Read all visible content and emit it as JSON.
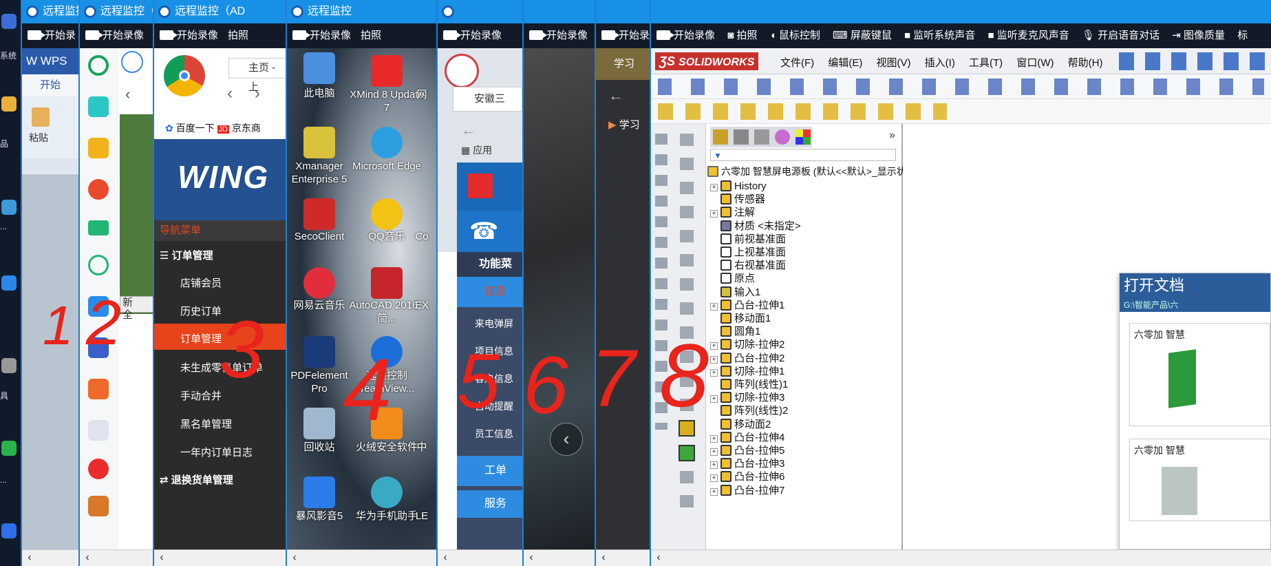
{
  "left_strip": {
    "labels": [
      "系统",
      "品",
      "...",
      "具",
      "..."
    ]
  },
  "windows": [
    {
      "title": "远程监控",
      "toolbar": [
        "开始录"
      ]
    },
    {
      "title": "远程监控（",
      "toolbar": [
        "开始录像"
      ]
    },
    {
      "title": "远程监控（AD",
      "toolbar": [
        "开始录像",
        "拍照"
      ]
    },
    {
      "title": "远程监控",
      "toolbar": [
        "开始录像",
        "拍照"
      ]
    },
    {
      "title": "",
      "toolbar": [
        "开始录像"
      ]
    },
    {
      "title": "",
      "toolbar": [
        "开始录像"
      ]
    },
    {
      "title": "",
      "toolbar": [
        "开始录"
      ]
    },
    {
      "title": "",
      "toolbar": [
        "开始录像",
        "拍照",
        "鼠标控制",
        "屏蔽键鼠",
        "监听系统声音",
        "监听麦克风声音",
        "开启语音对话",
        "图像质量",
        "标"
      ]
    }
  ],
  "w1": {
    "app": "WPS",
    "tab": "开始",
    "paste": "粘贴"
  },
  "w2": {
    "labels": [
      "新",
      "全"
    ]
  },
  "w3": {
    "tab": "主页 - 上",
    "bookmarks": [
      "百度一下",
      "京东商"
    ],
    "logo": "WING",
    "nav_title": "导航菜单",
    "section1": "订单管理",
    "items": [
      "店铺会员",
      "历史订单",
      "订单管理",
      "未生成零售单订单",
      "手动合并",
      "黑名单管理",
      "一年内订单日志"
    ],
    "section2": "退换货单管理"
  },
  "w4": {
    "icons": [
      [
        "此电脑",
        "XMind 8 Update 7",
        "网"
      ],
      [
        "Xmanager Enterprise 5",
        "Microsoft Edge",
        ""
      ],
      [
        "SecoClient",
        "QQ音乐",
        "Co"
      ],
      [
        "网易云音乐",
        "AutoCAD 2016 - 简...",
        "EX"
      ],
      [
        "PDFelement Pro",
        "远程控制 TeamView...",
        ""
      ],
      [
        "回收站",
        "火绒安全软件",
        "中"
      ],
      [
        "暴风影音5",
        "华为手机助手",
        "LE"
      ]
    ]
  },
  "w5": {
    "tab": "安徽三",
    "apps": "应用",
    "side_title": "功能菜",
    "side_sel": "信息",
    "items": [
      "来电弹屏",
      "项目信息",
      "客户信息",
      "自动提醒",
      "员工信息"
    ],
    "bottom": [
      "工单",
      "服务"
    ]
  },
  "w7": {
    "tab": "学习",
    "tab2": "学习"
  },
  "w8": {
    "brand": "SOLIDWORKS",
    "menu": [
      "文件(F)",
      "编辑(E)",
      "视图(V)",
      "插入(I)",
      "工具(T)",
      "窗口(W)",
      "帮助(H)"
    ],
    "root": "六零加 智慧屏电源板  (默认<<默认>_显示状",
    "tree": [
      {
        "label": "History",
        "exp": true
      },
      {
        "label": "传感器",
        "exp": false
      },
      {
        "label": "注解",
        "exp": true
      },
      {
        "label": "材质 <未指定>",
        "exp": false
      },
      {
        "label": "前视基准面",
        "exp": false
      },
      {
        "label": "上视基准面",
        "exp": false
      },
      {
        "label": "右视基准面",
        "exp": false
      },
      {
        "label": "原点",
        "exp": false
      },
      {
        "label": "输入1",
        "exp": false
      },
      {
        "label": "凸台-拉伸1",
        "exp": true
      },
      {
        "label": "移动面1",
        "exp": false
      },
      {
        "label": "圆角1",
        "exp": false
      },
      {
        "label": "切除-拉伸2",
        "exp": true
      },
      {
        "label": "凸台-拉伸2",
        "exp": true
      },
      {
        "label": "切除-拉伸1",
        "exp": true
      },
      {
        "label": "阵列(线性)1",
        "exp": false
      },
      {
        "label": "切除-拉伸3",
        "exp": true
      },
      {
        "label": "阵列(线性)2",
        "exp": false
      },
      {
        "label": "移动面2",
        "exp": false
      },
      {
        "label": "凸台-拉伸4",
        "exp": true
      },
      {
        "label": "凸台-拉伸5",
        "exp": true
      },
      {
        "label": "凸台-拉伸3",
        "exp": true
      },
      {
        "label": "凸台-拉伸6",
        "exp": true
      },
      {
        "label": "凸台-拉伸7",
        "exp": true
      }
    ],
    "open_doc": {
      "title": "打开文档",
      "path": "G:\\智能产品\\六",
      "item1": "六零加 智慧",
      "item2": "六零加 智慧"
    }
  },
  "handwriting": [
    "1",
    "2",
    "3",
    "4",
    "5",
    "6",
    "7",
    "8"
  ],
  "colors": {
    "titlebar": "#1890e6",
    "toolbar": "#121a28",
    "order_active": "#e8441c",
    "handwriting": "#e8241c"
  }
}
